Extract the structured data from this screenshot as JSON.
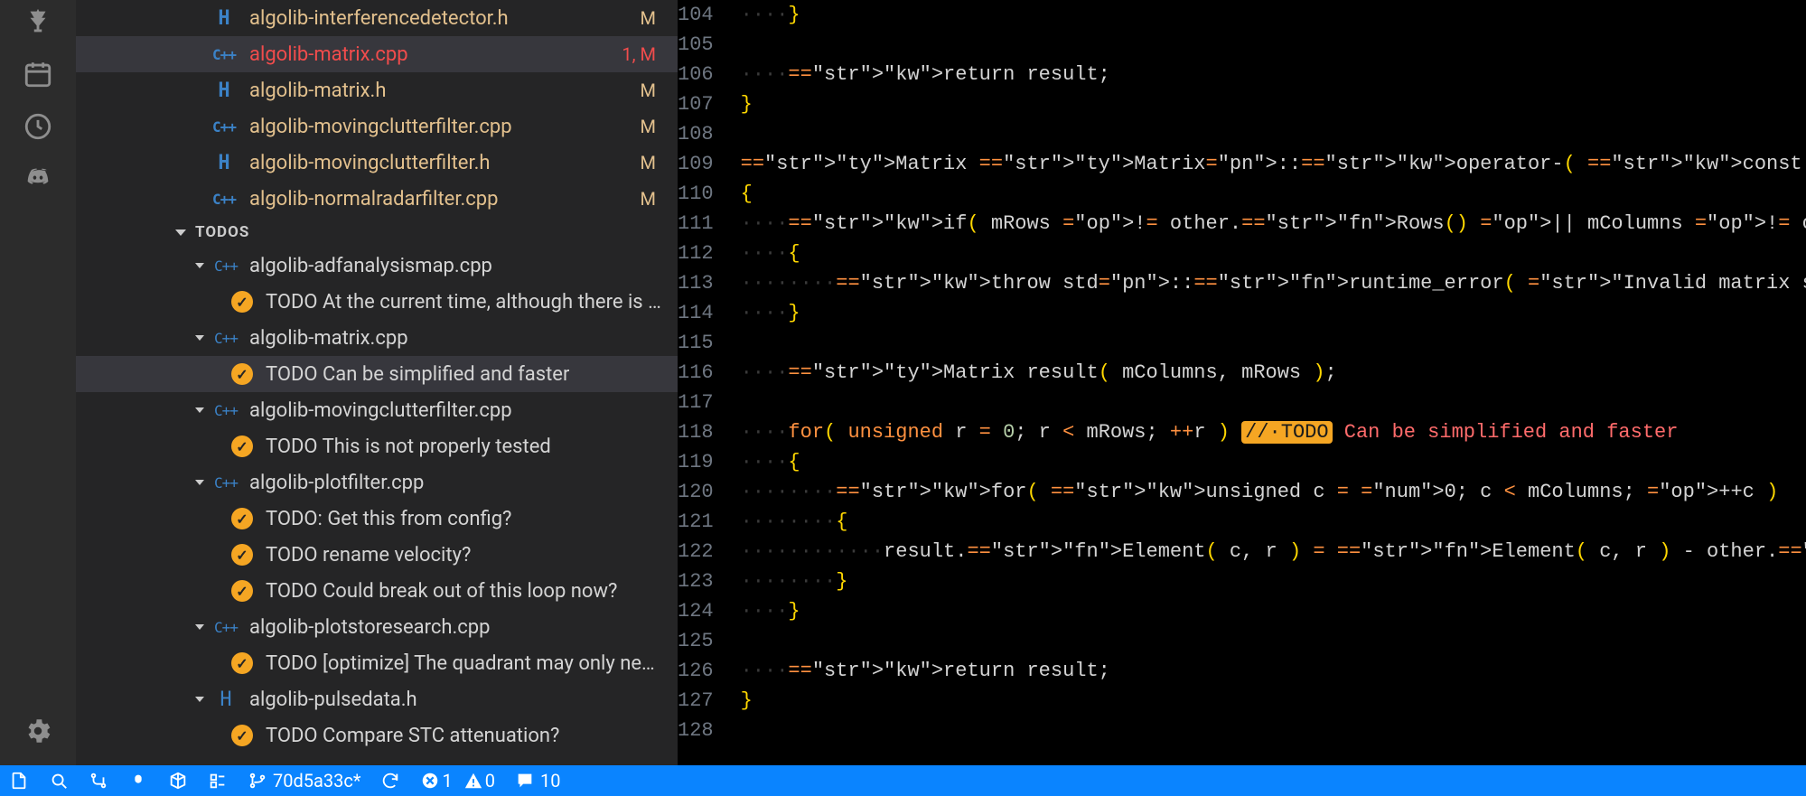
{
  "openEditors": [
    {
      "icon": "H",
      "name": "algolib-interferencedetector.h",
      "badge": "M",
      "active": false
    },
    {
      "icon": "C++",
      "name": "algolib-matrix.cpp",
      "badge": "1, M",
      "active": true
    },
    {
      "icon": "H",
      "name": "algolib-matrix.h",
      "badge": "M",
      "active": false
    },
    {
      "icon": "C++",
      "name": "algolib-movingclutterfilter.cpp",
      "badge": "M",
      "active": false
    },
    {
      "icon": "H",
      "name": "algolib-movingclutterfilter.h",
      "badge": "M",
      "active": false
    },
    {
      "icon": "C++",
      "name": "algolib-normalradarfilter.cpp",
      "badge": "M",
      "active": false
    }
  ],
  "todosHeader": "TODOS",
  "todos": [
    {
      "file": "algolib-adfanalysismap.cpp",
      "icon": "C++",
      "items": [
        {
          "text": "TODO At the current time, although there is s…",
          "active": false
        }
      ]
    },
    {
      "file": "algolib-matrix.cpp",
      "icon": "C++",
      "items": [
        {
          "text": "TODO Can be simplified and faster",
          "active": true
        }
      ]
    },
    {
      "file": "algolib-movingclutterfilter.cpp",
      "icon": "C++",
      "items": [
        {
          "text": "TODO This is not properly tested",
          "active": false
        }
      ]
    },
    {
      "file": "algolib-plotfilter.cpp",
      "icon": "C++",
      "items": [
        {
          "text": "TODO: Get this from config?",
          "active": false
        },
        {
          "text": "TODO rename velocity?",
          "active": false
        },
        {
          "text": "TODO Could break out of this loop now?",
          "active": false
        }
      ]
    },
    {
      "file": "algolib-plotstoresearch.cpp",
      "icon": "C++",
      "items": [
        {
          "text": "TODO [optimize] The quadrant may only need…",
          "active": false
        }
      ]
    },
    {
      "file": "algolib-pulsedata.h",
      "icon": "H",
      "items": [
        {
          "text": "TODO Compare STC attenuation?",
          "active": false
        }
      ]
    }
  ],
  "code": {
    "start": 104,
    "lines": [
      "····}",
      "",
      "····return result;",
      "}",
      "",
      "Matrix Matrix::operator-( const Matrix& other ) const",
      "{",
      "····if( mRows != other.Rows() || mColumns != other.Columns() )",
      "····{",
      "········throw std::runtime_error( \"Invalid matrix subtraction\" );",
      "····}",
      "",
      "····Matrix result( mColumns, mRows );",
      "",
      "····for( unsigned r = 0; r < mRows; ++r ) //·TODO Can be simplified and faster",
      "····{",
      "········for( unsigned c = 0; c < mColumns; ++c )",
      "········{",
      "············result.Element( c, r ) = Element( c, r ) - other.Element( c, r );",
      "········}",
      "····}",
      "",
      "····return result;",
      "}",
      ""
    ]
  },
  "status": {
    "branch": "70d5a33c*",
    "errors": "1",
    "warnings": "0",
    "comments": "10"
  }
}
